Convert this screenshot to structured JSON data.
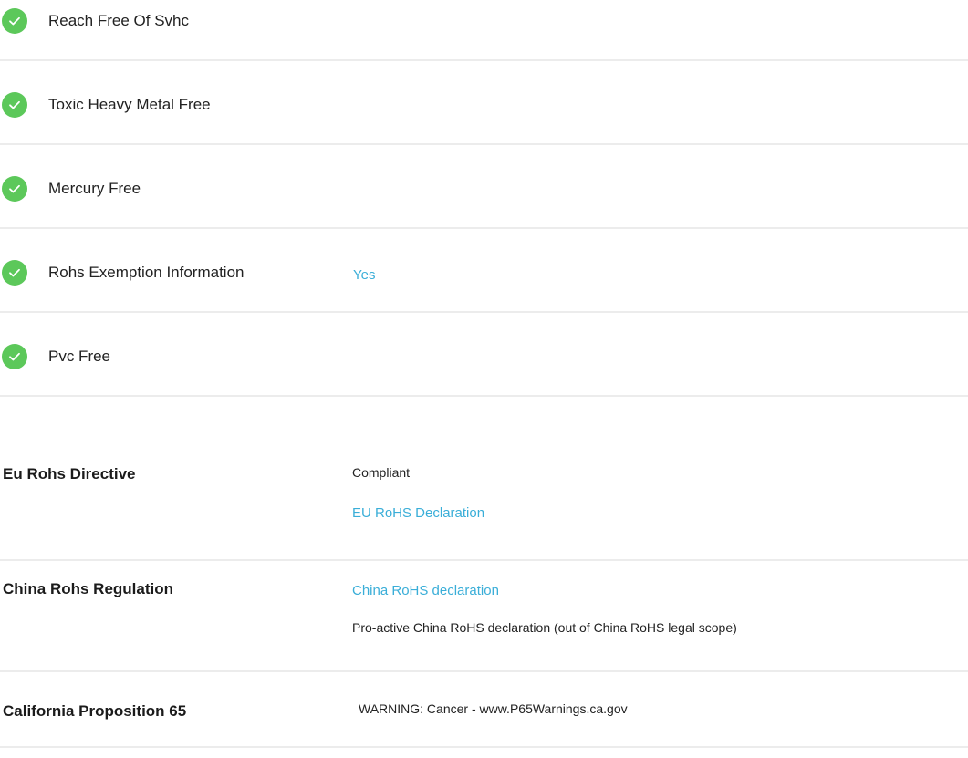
{
  "environmental": {
    "items": [
      {
        "label": "Reach Free Of Svhc",
        "value": "",
        "icon": "check-circle-icon"
      },
      {
        "label": "Toxic Heavy Metal Free",
        "value": "",
        "icon": "check-circle-icon"
      },
      {
        "label": "Mercury Free",
        "value": "",
        "icon": "check-circle-icon"
      },
      {
        "label": "Rohs Exemption Information",
        "value": "Yes",
        "icon": "check-circle-icon"
      },
      {
        "label": "Pvc Free",
        "value": "",
        "icon": "check-circle-icon"
      }
    ],
    "check_color": "#5cc85a",
    "link_color": "#3aaed8"
  },
  "regulations": {
    "eu_rohs": {
      "label": "Eu Rohs Directive",
      "status": "Compliant",
      "link": "EU RoHS Declaration"
    },
    "china_rohs": {
      "label": "China Rohs Regulation",
      "link": "China RoHS declaration",
      "note": "Pro-active China RoHS declaration (out of China RoHS legal scope)"
    },
    "california_prop65": {
      "label": "California Proposition 65",
      "warning": "WARNING: Cancer - www.P65Warnings.ca.gov"
    }
  }
}
